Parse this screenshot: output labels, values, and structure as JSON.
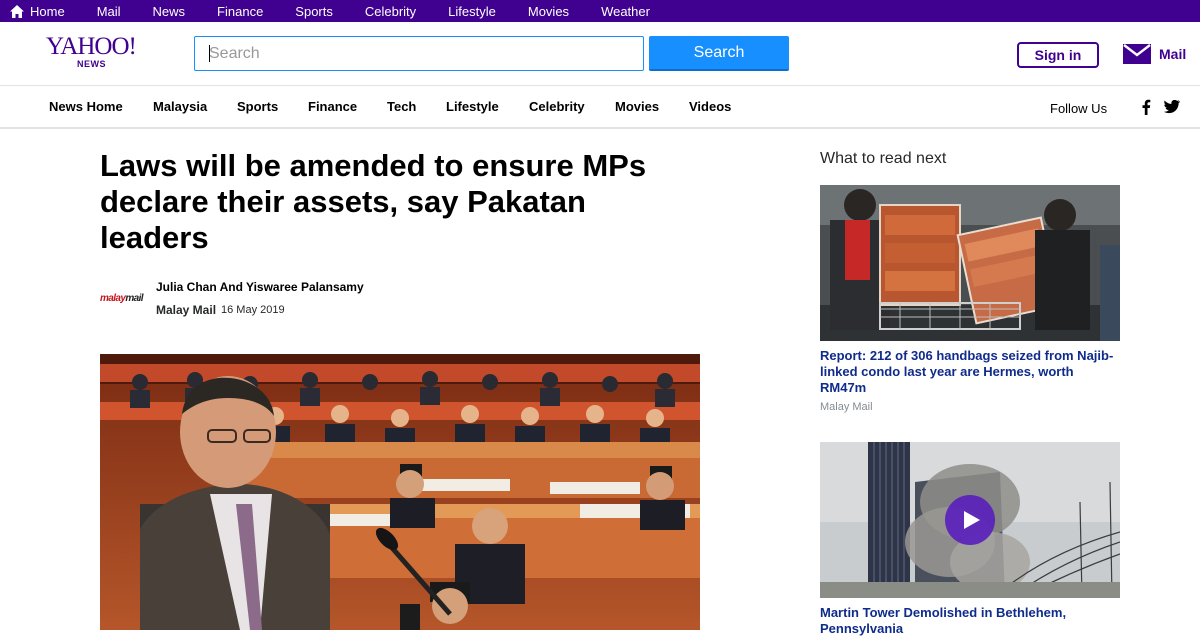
{
  "topbar": {
    "items": [
      "Home",
      "Mail",
      "News",
      "Finance",
      "Sports",
      "Celebrity",
      "Lifestyle",
      "Movies",
      "Weather"
    ],
    "bg_color": "#400090"
  },
  "header": {
    "logo_brand": "YAHOO!",
    "logo_sub": "NEWS",
    "search_placeholder": "Search",
    "search_button": "Search",
    "signin_label": "Sign in",
    "mail_label": "Mail"
  },
  "nav": {
    "items": [
      "News Home",
      "Malaysia",
      "Sports",
      "Finance",
      "Tech",
      "Lifestyle",
      "Celebrity",
      "Movies",
      "Videos"
    ],
    "follow_label": "Follow Us",
    "icons": [
      "facebook-icon",
      "twitter-icon"
    ]
  },
  "article": {
    "headline": "Laws will be amended to ensure MPs declare their assets, say Pakatan leaders",
    "publisher_logo": [
      "malay",
      "mail"
    ],
    "author": "Julia Chan And Yiswaree Palansamy",
    "source": "Malay Mail",
    "date": "16 May 2019"
  },
  "sidebar": {
    "title": "What to read next",
    "cards": [
      {
        "title": "Report: 212 of 306 handbags seized from Najib-linked condo last year are Hermes, worth RM47m",
        "source": "Malay Mail"
      },
      {
        "title": "Martin Tower Demolished in Bethlehem, Pennsylvania",
        "is_video": true
      }
    ]
  },
  "colors": {
    "brand_purple": "#400090",
    "search_blue": "#188fff",
    "link_navy": "#0f2b8c"
  }
}
